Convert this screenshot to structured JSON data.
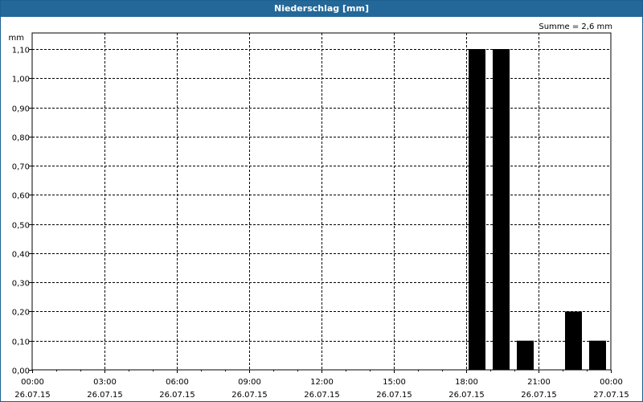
{
  "window": {
    "title": "Niederschlag [mm]"
  },
  "chart_data": {
    "type": "bar",
    "title": "Niederschlag [mm]",
    "ylabel": "mm",
    "sum_label": "Summe = 2,6 mm",
    "ylim": [
      0,
      1.15
    ],
    "xlim_hours": [
      0,
      24
    ],
    "y_ticks": [
      {
        "v": 0.0,
        "label": "0,00"
      },
      {
        "v": 0.1,
        "label": "0,10"
      },
      {
        "v": 0.2,
        "label": "0,20"
      },
      {
        "v": 0.3,
        "label": "0,30"
      },
      {
        "v": 0.4,
        "label": "0,40"
      },
      {
        "v": 0.5,
        "label": "0,50"
      },
      {
        "v": 0.6,
        "label": "0,60"
      },
      {
        "v": 0.7,
        "label": "0,70"
      },
      {
        "v": 0.8,
        "label": "0,80"
      },
      {
        "v": 0.9,
        "label": "0,90"
      },
      {
        "v": 1.0,
        "label": "1,00"
      },
      {
        "v": 1.1,
        "label": "1,10"
      }
    ],
    "x_ticks": [
      {
        "h": 0,
        "time": "00:00",
        "date": "26.07.15"
      },
      {
        "h": 3,
        "time": "03:00",
        "date": "26.07.15"
      },
      {
        "h": 6,
        "time": "06:00",
        "date": "26.07.15"
      },
      {
        "h": 9,
        "time": "09:00",
        "date": "26.07.15"
      },
      {
        "h": 12,
        "time": "12:00",
        "date": "26.07.15"
      },
      {
        "h": 15,
        "time": "15:00",
        "date": "26.07.15"
      },
      {
        "h": 18,
        "time": "18:00",
        "date": "26.07.15"
      },
      {
        "h": 21,
        "time": "21:00",
        "date": "26.07.15"
      },
      {
        "h": 24,
        "time": "00:00",
        "date": "27.07.15"
      }
    ],
    "bars": [
      {
        "hour": 18,
        "value": 1.1
      },
      {
        "hour": 19,
        "value": 1.1
      },
      {
        "hour": 20,
        "value": 0.1
      },
      {
        "hour": 22,
        "value": 0.2
      },
      {
        "hour": 23,
        "value": 0.1
      }
    ],
    "grid": true
  }
}
